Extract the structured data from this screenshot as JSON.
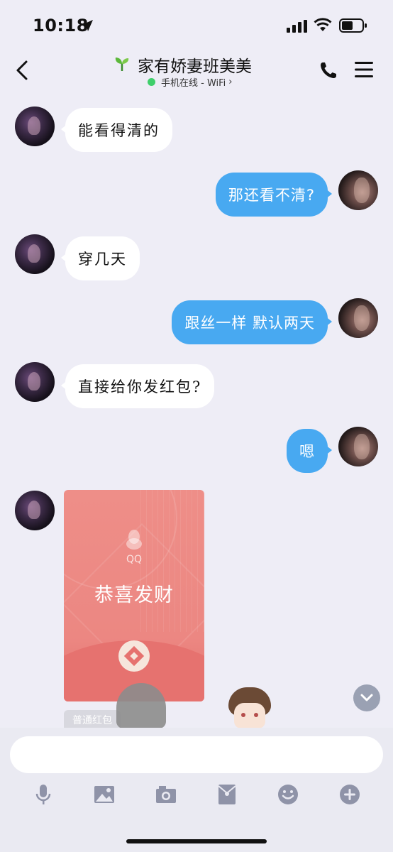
{
  "status_bar": {
    "time": "10:18"
  },
  "header": {
    "title": "家有娇妻班美美",
    "presence": "手机在线 - WiFi",
    "presence_chevron": "›"
  },
  "messages": [
    {
      "side": "left",
      "text": "能看得清的"
    },
    {
      "side": "right",
      "text": "那还看不清?"
    },
    {
      "side": "left",
      "text": "穿几天"
    },
    {
      "side": "right",
      "text": "跟丝一样 默认两天"
    },
    {
      "side": "left",
      "text": "直接给你发红包?"
    },
    {
      "side": "right",
      "text": "嗯"
    }
  ],
  "red_packet": {
    "brand": "QQ",
    "title": "恭喜发财",
    "label": "普通红包"
  },
  "input": {
    "placeholder": ""
  },
  "toolbar": [
    "mic-icon",
    "image-icon",
    "camera-icon",
    "red-packet-icon",
    "emoji-icon",
    "plus-icon"
  ],
  "colors": {
    "background": "#eeedf6",
    "bubble_right": "#48a9f1",
    "bubble_left": "#ffffff",
    "red_packet": "#ec8782",
    "presence_online": "#3fcf6b",
    "icon_gray": "#8f93a8"
  }
}
